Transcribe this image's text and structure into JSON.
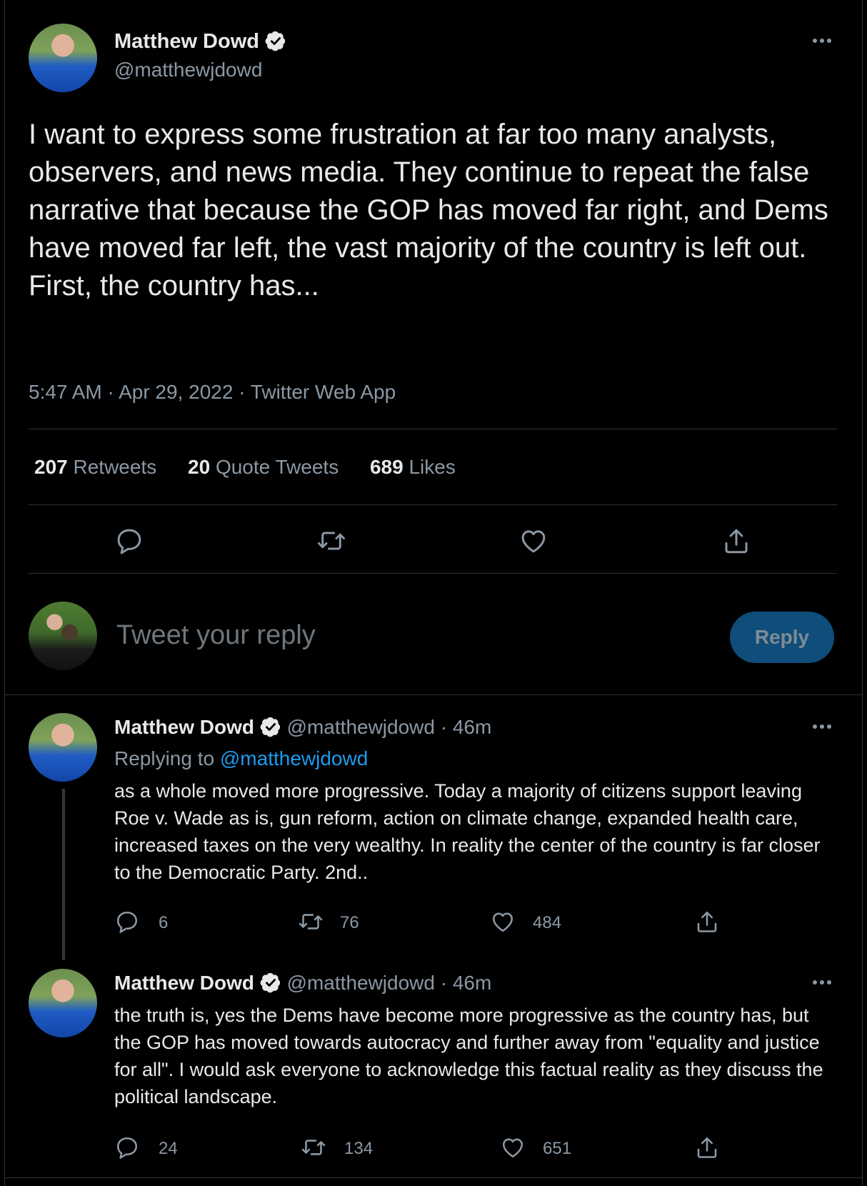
{
  "main_tweet": {
    "author_name": "Matthew Dowd",
    "handle": "@matthewjdowd",
    "text": "I want to express some frustration at far too many analysts, observers, and news media.  They continue to repeat the false narrative that because the GOP has moved far right, and Dems have moved far left, the vast majority of the country is left out.  First, the country has...",
    "meta": "5:47 AM · Apr 29, 2022 · Twitter Web App",
    "stats": {
      "retweets": "207",
      "retweets_label": "Retweets",
      "quotes": "20",
      "quotes_label": "Quote Tweets",
      "likes": "689",
      "likes_label": "Likes"
    }
  },
  "compose": {
    "placeholder": "Tweet your reply",
    "button_label": "Reply"
  },
  "replies": [
    {
      "author_name": "Matthew Dowd",
      "handle": "@matthewjdowd",
      "time": "· 46m",
      "replying_to_label": "Replying to",
      "replying_to_handle": "@matthewjdowd",
      "text": "as a whole moved more progressive.  Today a majority of citizens support leaving Roe v. Wade as is, gun reform, action on climate change, expanded health care, increased taxes on the very wealthy.  In reality the center of the country is far closer to the Democratic Party.  2nd..",
      "reply_count": "6",
      "retweet_count": "76",
      "like_count": "484"
    },
    {
      "author_name": "Matthew Dowd",
      "handle": "@matthewjdowd",
      "time": "· 46m",
      "text": "the truth is, yes the Dems have become more progressive as the country has, but the GOP has moved towards autocracy and further away from \"equality and justice for all\".  I would ask everyone to acknowledge this factual reality as they discuss the political landscape.",
      "reply_count": "24",
      "retweet_count": "134",
      "like_count": "651"
    }
  ],
  "colors": {
    "background": "#000000",
    "text": "#e7e9ea",
    "muted": "#8b98a5",
    "link": "#1d9bf0",
    "divider": "#2f3336",
    "reply_button": "#0f4d7a"
  }
}
